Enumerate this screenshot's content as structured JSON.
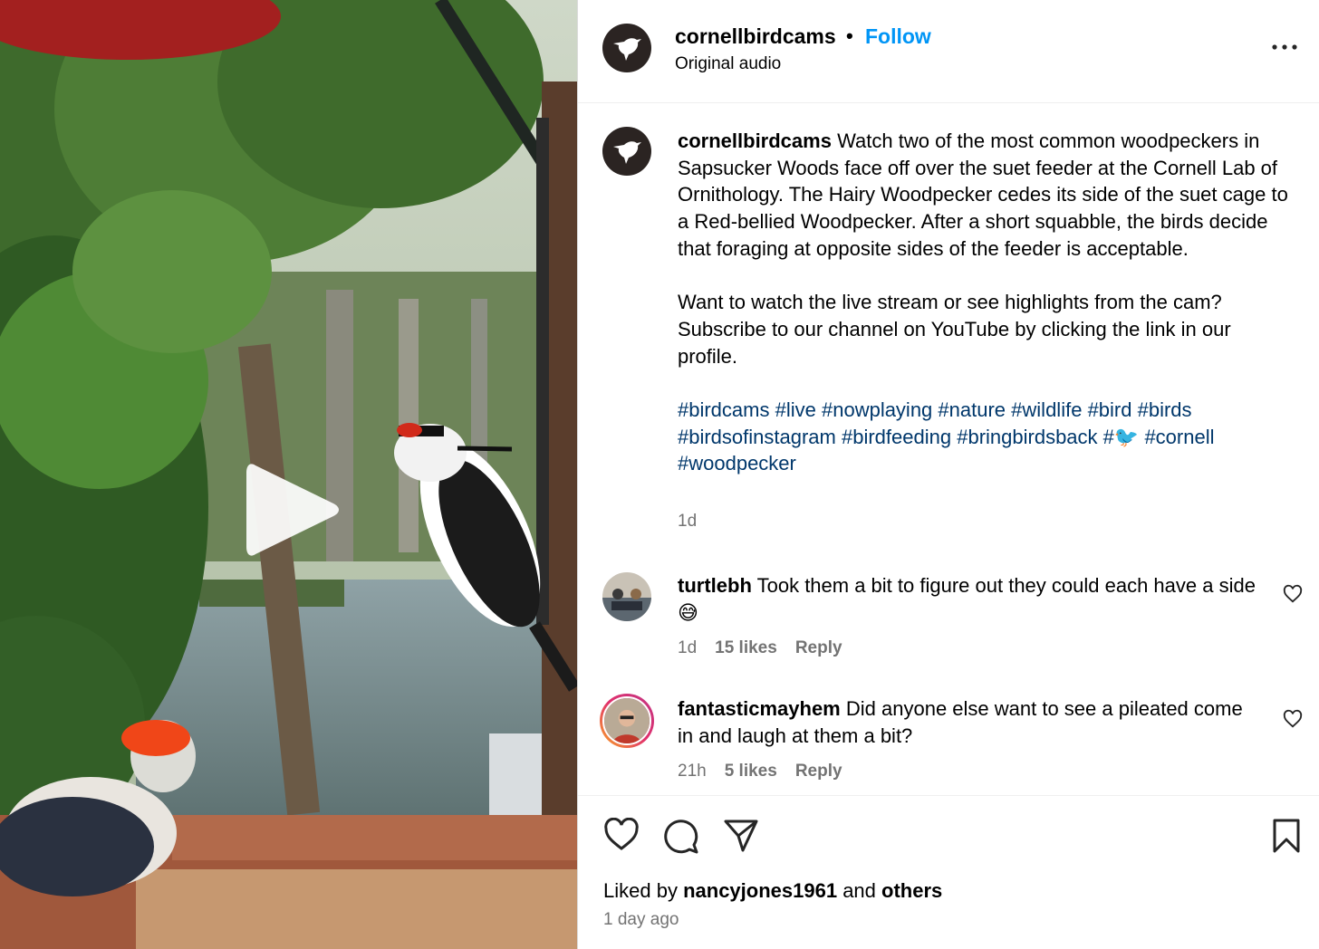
{
  "post": {
    "username": "cornellbirdcams",
    "separator": "•",
    "follow_label": "Follow",
    "audio": "Original audio"
  },
  "caption": {
    "username": "cornellbirdcams",
    "paragraph1": "Watch two of the most common woodpeckers in Sapsucker Woods face off over the suet feeder at the Cornell Lab of Ornithology. The Hairy Woodpecker cedes its side of the suet cage to a Red-bellied Woodpecker. After a short squabble, the birds decide that foraging at opposite sides of the feeder is acceptable.",
    "paragraph2": "Want to watch the live stream or see highlights from the cam? Subscribe to our channel on YouTube by clicking the link in our profile.",
    "tags": [
      "#birdcams",
      "#live",
      "#nowplaying",
      "#nature",
      "#wildlife",
      "#bird",
      "#birds",
      "#birdsofinstagram",
      "#birdfeeding",
      "#bringbirdsback",
      "#🐦",
      "#cornell",
      "#woodpecker"
    ],
    "time": "1d"
  },
  "comments": [
    {
      "username": "turtlebh",
      "text": "Took them a bit to figure out they could each have a side 😅",
      "time": "1d",
      "likes": "15 likes",
      "reply": "Reply"
    },
    {
      "username": "fantasticmayhem",
      "text": "Did anyone else want to see a pileated come in and laugh at them a bit?",
      "time": "21h",
      "likes": "5 likes",
      "reply": "Reply"
    }
  ],
  "footer": {
    "liked_by_prefix": "Liked by",
    "liked_by_user": "nancyjones1961",
    "and": "and",
    "others": "others",
    "posted_ago": "1 day ago"
  },
  "icons": {
    "avatar": "hummingbird-logo-icon",
    "more": "more-options-icon",
    "play": "play-icon",
    "like": "heart-icon",
    "comment": "comment-icon",
    "share": "share-icon",
    "save": "bookmark-icon"
  },
  "colors": {
    "link_blue": "#0095f6",
    "hashtag": "#00376b",
    "muted": "#737373",
    "story_ring_start": "#f9a825",
    "story_ring_end": "#c13584"
  }
}
